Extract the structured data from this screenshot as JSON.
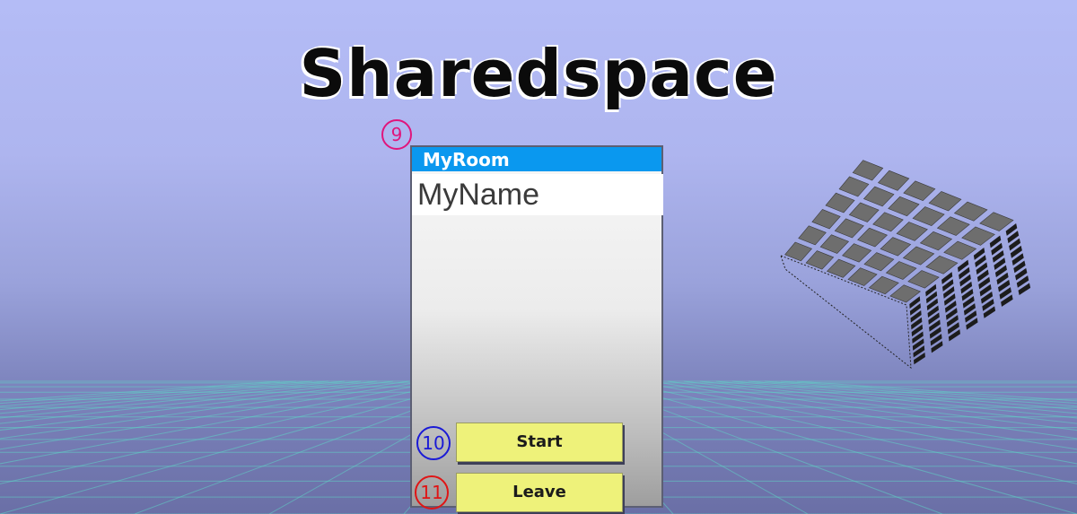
{
  "game": {
    "title": "Sharedspace"
  },
  "panel": {
    "room_name": "MyRoom",
    "player_name": "MyName",
    "start_label": "Start",
    "leave_label": "Leave"
  },
  "markers": {
    "m9": "9",
    "m10": "10",
    "m11": "11"
  },
  "colors": {
    "sky": "#b4bcf6",
    "room_bar": "#0a98ef",
    "button": "#eef27a",
    "grid_line": "#5fd3c6",
    "marker_9": "#e0157c",
    "marker_10": "#1a1ad6",
    "marker_11": "#e01515"
  },
  "icons": {
    "cube": "tiled-cube-icon"
  }
}
